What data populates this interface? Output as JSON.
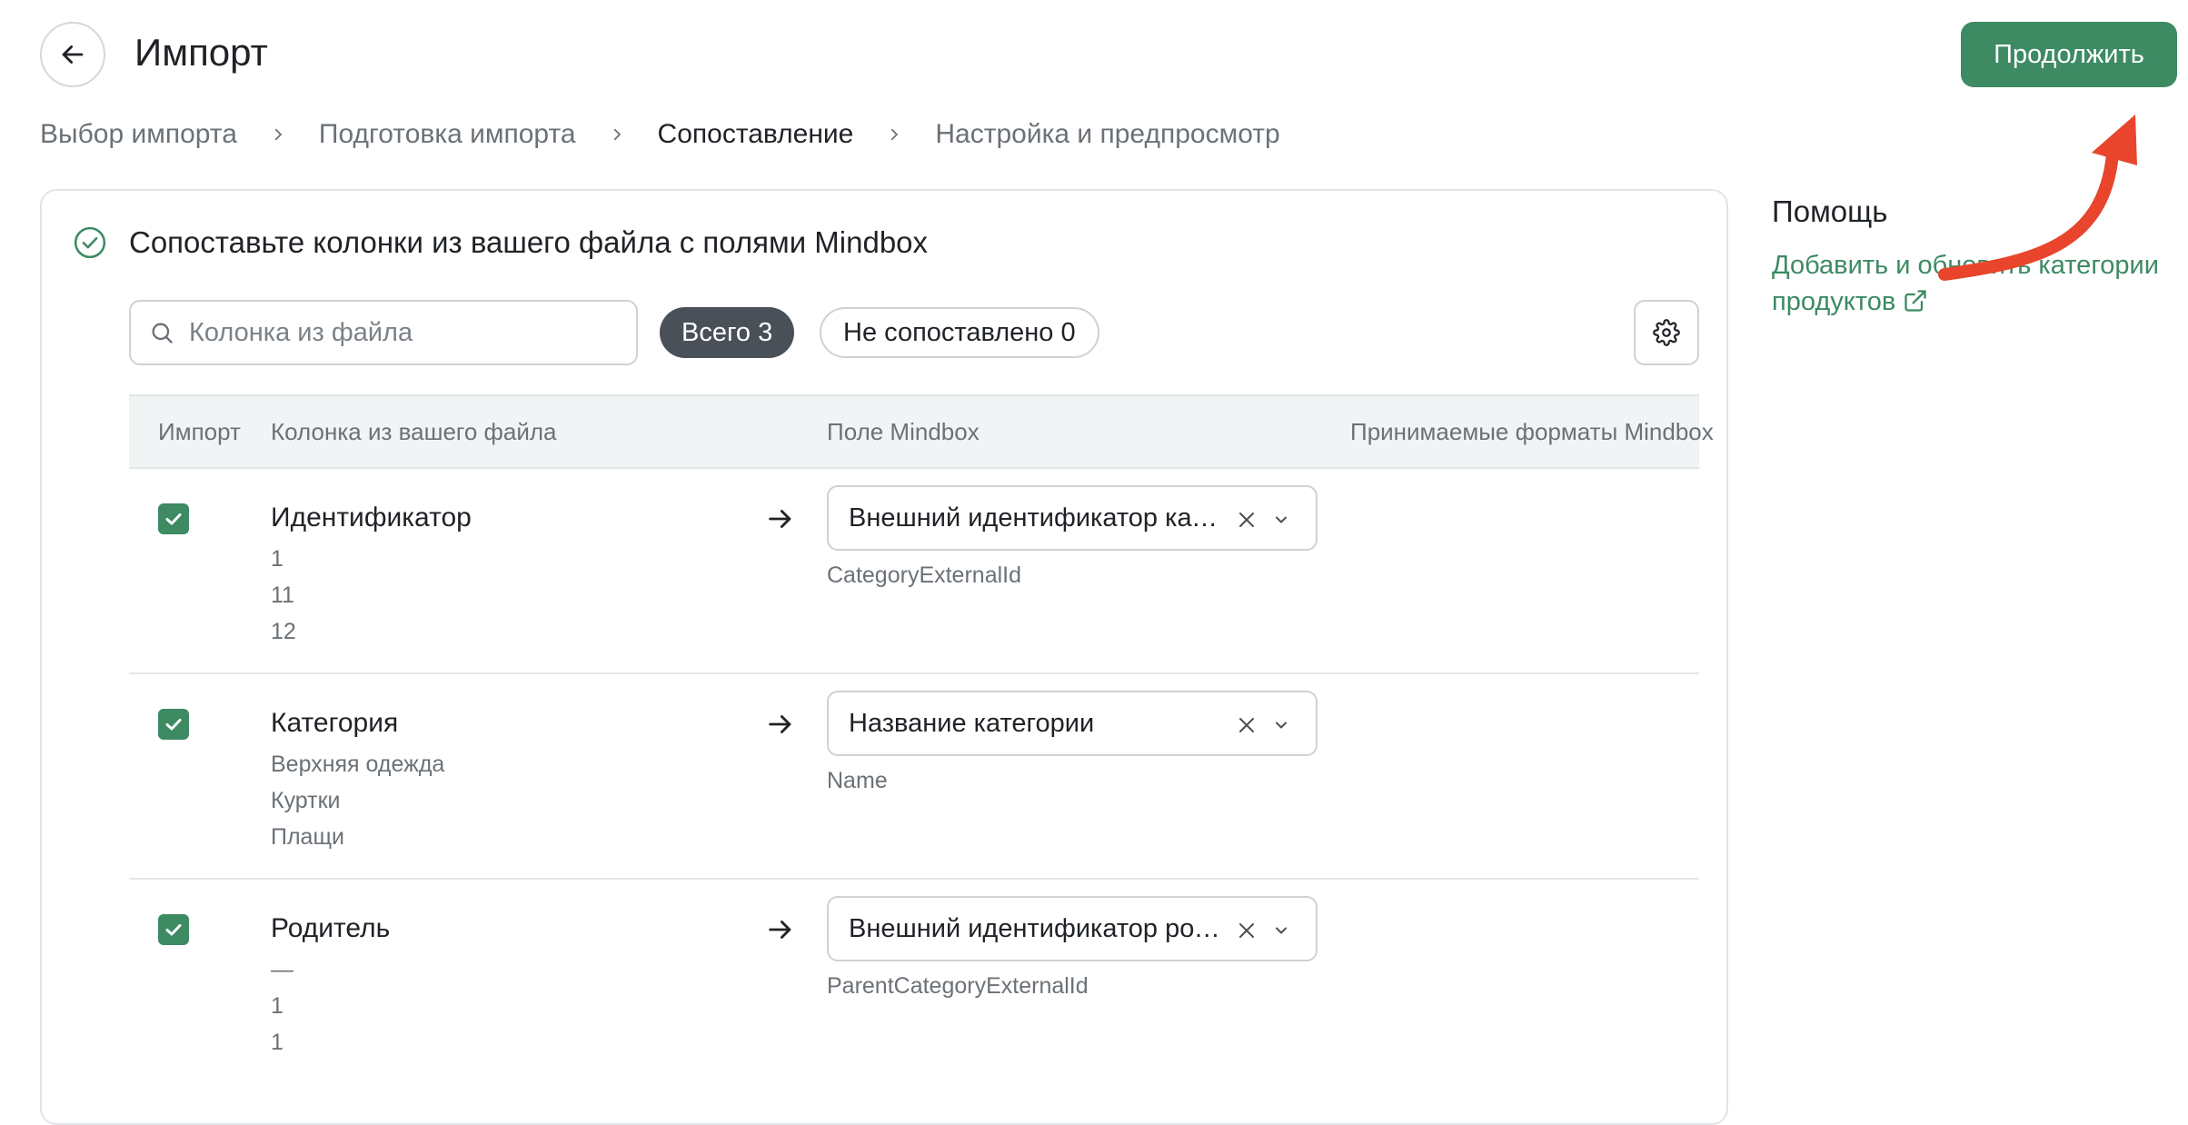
{
  "header": {
    "title": "Импорт",
    "continue_label": "Продолжить"
  },
  "breadcrumbs": [
    {
      "label": "Выбор импорта",
      "active": false
    },
    {
      "label": "Подготовка импорта",
      "active": false
    },
    {
      "label": "Сопоставление",
      "active": true
    },
    {
      "label": "Настройка и предпросмотр",
      "active": false
    }
  ],
  "mapping": {
    "heading": "Сопоставьте колонки из вашего файла с полями Mindbox",
    "search_placeholder": "Колонка из файла",
    "filter_total": "Всего 3",
    "filter_unmapped": "Не сопоставлено 0",
    "columns": {
      "import": "Импорт",
      "file_column": "Колонка из вашего файла",
      "mindbox_field": "Поле Mindbox",
      "formats": "Принимаемые форматы Mindbox"
    },
    "rows": [
      {
        "checked": true,
        "name": "Идентификатор",
        "samples": [
          "1",
          "11",
          "12"
        ],
        "field": "Внешний идентификатор категории",
        "system_name": "CategoryExternalId"
      },
      {
        "checked": true,
        "name": "Категория",
        "samples": [
          "Верхняя одежда",
          "Куртки",
          "Плащи"
        ],
        "field": "Название категории",
        "system_name": "Name"
      },
      {
        "checked": true,
        "name": "Родитель",
        "samples": [
          "—",
          "1",
          "1"
        ],
        "field": "Внешний идентификатор родительской категории",
        "system_name": "ParentCategoryExternalId"
      }
    ]
  },
  "help": {
    "title": "Помощь",
    "link": "Добавить и обновить категории продуктов"
  },
  "colors": {
    "accent": "#3d8a63",
    "chip_dark": "#4a5058",
    "annotation": "#e8452c"
  },
  "icons": [
    "arrow-left-icon",
    "check-circle-icon",
    "search-icon",
    "gear-icon",
    "checkmark-icon",
    "arrow-right-icon",
    "close-icon",
    "chevron-down-icon",
    "external-link-icon",
    "chevron-right-icon"
  ]
}
